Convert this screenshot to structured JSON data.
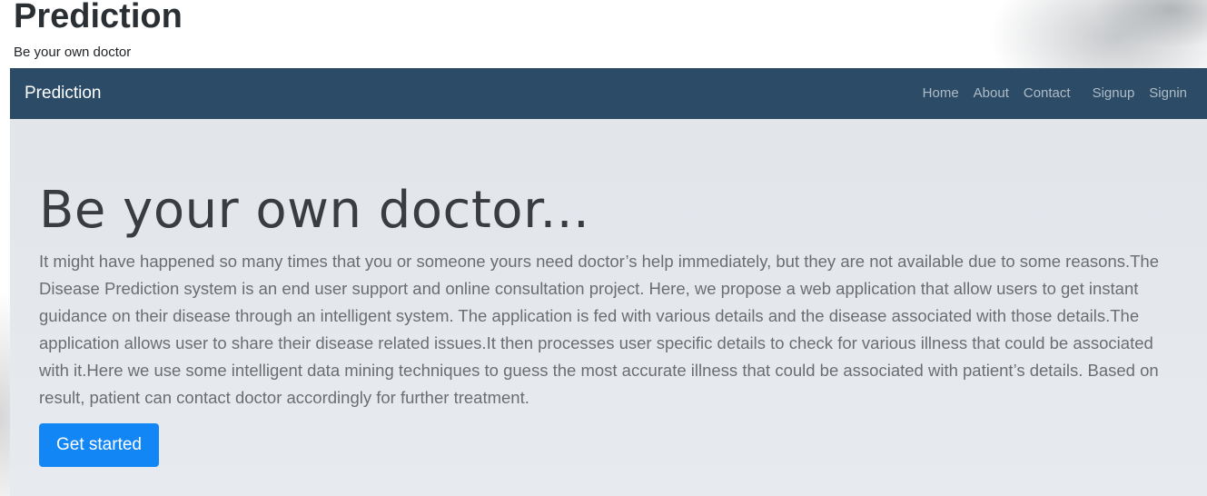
{
  "header": {
    "title": "Prediction",
    "tagline": "Be your own doctor"
  },
  "navbar": {
    "brand": "Prediction",
    "links": [
      {
        "label": "Home"
      },
      {
        "label": "About"
      },
      {
        "label": "Contact"
      },
      {
        "label": "Signup"
      },
      {
        "label": "Signin"
      }
    ],
    "background_color": "#2b4b66"
  },
  "hero": {
    "heading": "Be your own doctor...",
    "body": "It might have happened so many times that you or someone yours need doctor’s help immediately, but they are not available due to some reasons.The Disease Prediction system is an end user support and online consultation project. Here, we propose a web application that allow users to get instant guidance on their disease through an intelligent system. The application is fed with various details and the disease associated with those details.The application allows user to share their disease related issues.It then processes user specific details to check for various illness that could be associated with it.Here we use some intelligent data mining techniques to guess the most accurate illness that could be associated with patient’s details. Based on result, patient can contact doctor accordingly for further treatment.",
    "cta_label": "Get started",
    "cta_color": "#1386f5"
  }
}
